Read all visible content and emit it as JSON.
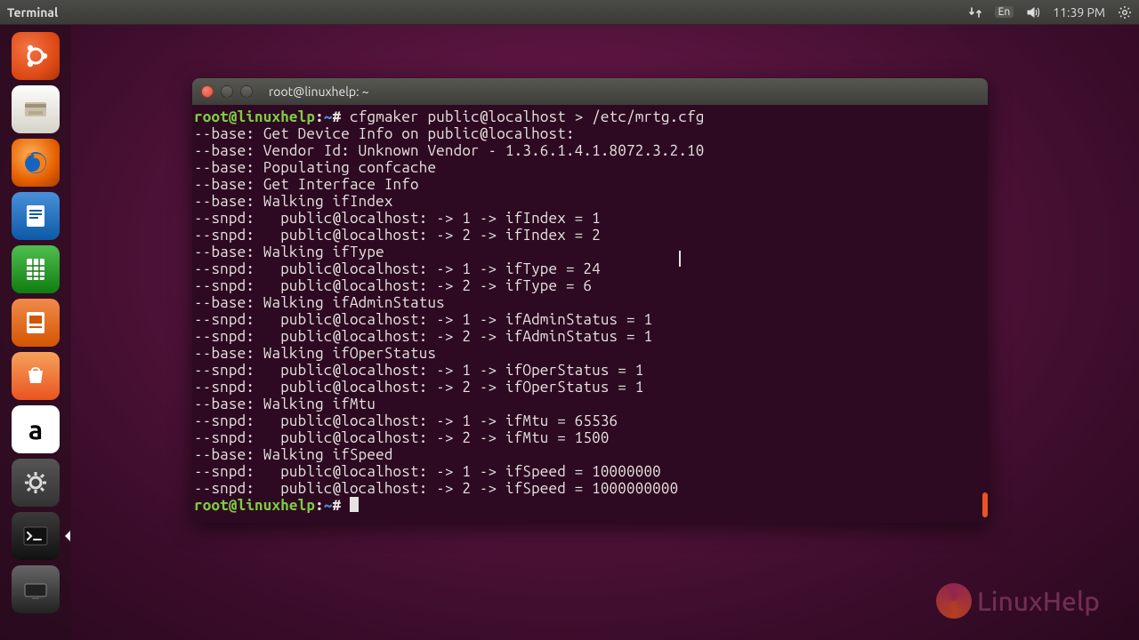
{
  "menubar": {
    "app_title": "Terminal",
    "lang_indicator": "En",
    "time": "11:39 PM"
  },
  "launcher": {
    "items": [
      {
        "name": "ubuntu-dash"
      },
      {
        "name": "files"
      },
      {
        "name": "firefox"
      },
      {
        "name": "libreoffice-writer"
      },
      {
        "name": "libreoffice-calc"
      },
      {
        "name": "libreoffice-impress"
      },
      {
        "name": "software-center"
      },
      {
        "name": "amazon",
        "glyph": "a"
      },
      {
        "name": "system-settings"
      },
      {
        "name": "terminal"
      },
      {
        "name": "workspace-switcher"
      }
    ]
  },
  "terminal": {
    "window_title": "root@linuxhelp: ~",
    "prompt_user": "root@linuxhelp",
    "prompt_path": "~",
    "prompt_char": "#",
    "command": "cfgmaker public@localhost > /etc/mrtg.cfg",
    "output": [
      "--base: Get Device Info on public@localhost:",
      "--base: Vendor Id: Unknown Vendor - 1.3.6.1.4.1.8072.3.2.10",
      "--base: Populating confcache",
      "--base: Get Interface Info",
      "--base: Walking ifIndex",
      "--snpd:   public@localhost: -> 1 -> ifIndex = 1",
      "--snpd:   public@localhost: -> 2 -> ifIndex = 2",
      "--base: Walking ifType",
      "--snpd:   public@localhost: -> 1 -> ifType = 24",
      "--snpd:   public@localhost: -> 2 -> ifType = 6",
      "--base: Walking ifAdminStatus",
      "--snpd:   public@localhost: -> 1 -> ifAdminStatus = 1",
      "--snpd:   public@localhost: -> 2 -> ifAdminStatus = 1",
      "--base: Walking ifOperStatus",
      "--snpd:   public@localhost: -> 1 -> ifOperStatus = 1",
      "--snpd:   public@localhost: -> 2 -> ifOperStatus = 1",
      "--base: Walking ifMtu",
      "--snpd:   public@localhost: -> 1 -> ifMtu = 65536",
      "--snpd:   public@localhost: -> 2 -> ifMtu = 1500",
      "--base: Walking ifSpeed",
      "--snpd:   public@localhost: -> 1 -> ifSpeed = 10000000",
      "--snpd:   public@localhost: -> 2 -> ifSpeed = 1000000000"
    ]
  },
  "watermark": {
    "text": "LinuxHelp"
  }
}
